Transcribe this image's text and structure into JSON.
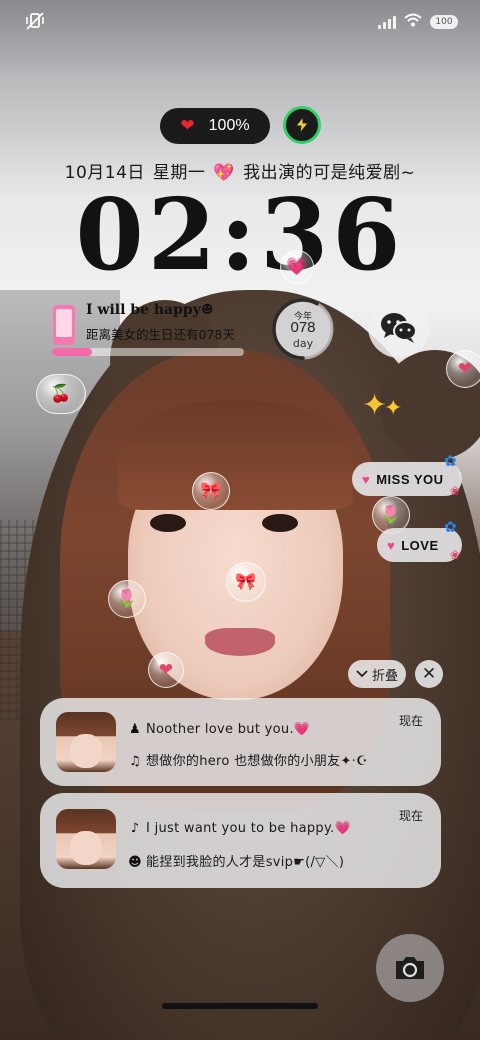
{
  "status_bar": {
    "battery_text": "100",
    "left_icon": "vibrate-off-icon",
    "signal_icon": "signal-icon",
    "wifi_icon": "wifi-icon"
  },
  "battery_widget": {
    "icon": "heart-icon",
    "percent": "100%",
    "charge_icon": "lightning-bolt-icon"
  },
  "date_line": {
    "date": "10月14日",
    "weekday": "星期一",
    "emoji": "💖",
    "motto": "我出演的可是纯爱剧~"
  },
  "clock": {
    "time": "02:36"
  },
  "countdown_widget": {
    "title": "I will be happy☻",
    "subtitle": "距离美女的生日还有078天",
    "progress": 0.21,
    "progress_color": "#f26aa8"
  },
  "day_widget": {
    "label": "今年",
    "number": "078",
    "unit": "day",
    "progress": 0.58
  },
  "wechat_widget": {
    "icon": "wechat-icon"
  },
  "stickers": {
    "miss_you": "MISS YOU",
    "love": "LOVE",
    "heart_glyph": "💗"
  },
  "fold_controls": {
    "fold_label": "折叠",
    "close_label": "✕"
  },
  "notifications": [
    {
      "app_icon": "qq-penguin-icon",
      "line1": "Noother love but you.💗",
      "line2_icon": "music-note-icon",
      "line2": "想做你的hero 也想做你的小朋友✦·☪",
      "time": "现在"
    },
    {
      "app_icon": "tiktok-icon",
      "line1": "I just want you to be happy.💗",
      "line2_icon": "smiley-icon",
      "line2": "能捏到我脸的人才是svip☛(/▽＼)",
      "time": "现在"
    }
  ],
  "camera": {
    "icon": "camera-icon"
  },
  "colors": {
    "accent_pink": "#f26aa8",
    "charge_green": "#33d06a",
    "clock_color": "#121212"
  }
}
